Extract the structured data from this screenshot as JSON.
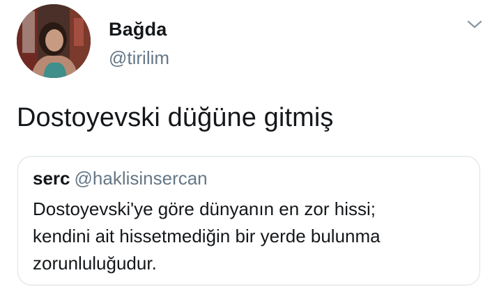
{
  "tweet": {
    "author": {
      "display_name": "Bağda",
      "handle": "@tirilim",
      "avatar_icon": "profile-photo"
    },
    "menu_icon": "chevron-down-icon",
    "text": "Dostoyevski düğüne gitmiş",
    "quote": {
      "author_name": "serc",
      "author_handle": "@haklisinsercan",
      "lines": [
        "Dostoyevski'ye göre dünyanın en zor hissi;",
        "kendini ait hissetmediğin bir yerde bulunma",
        "zorunluluğudur."
      ]
    }
  },
  "colors": {
    "primary_text": "#14171a",
    "secondary_text": "#657786",
    "card_border": "#d8e0e6",
    "background": "#ffffff"
  }
}
